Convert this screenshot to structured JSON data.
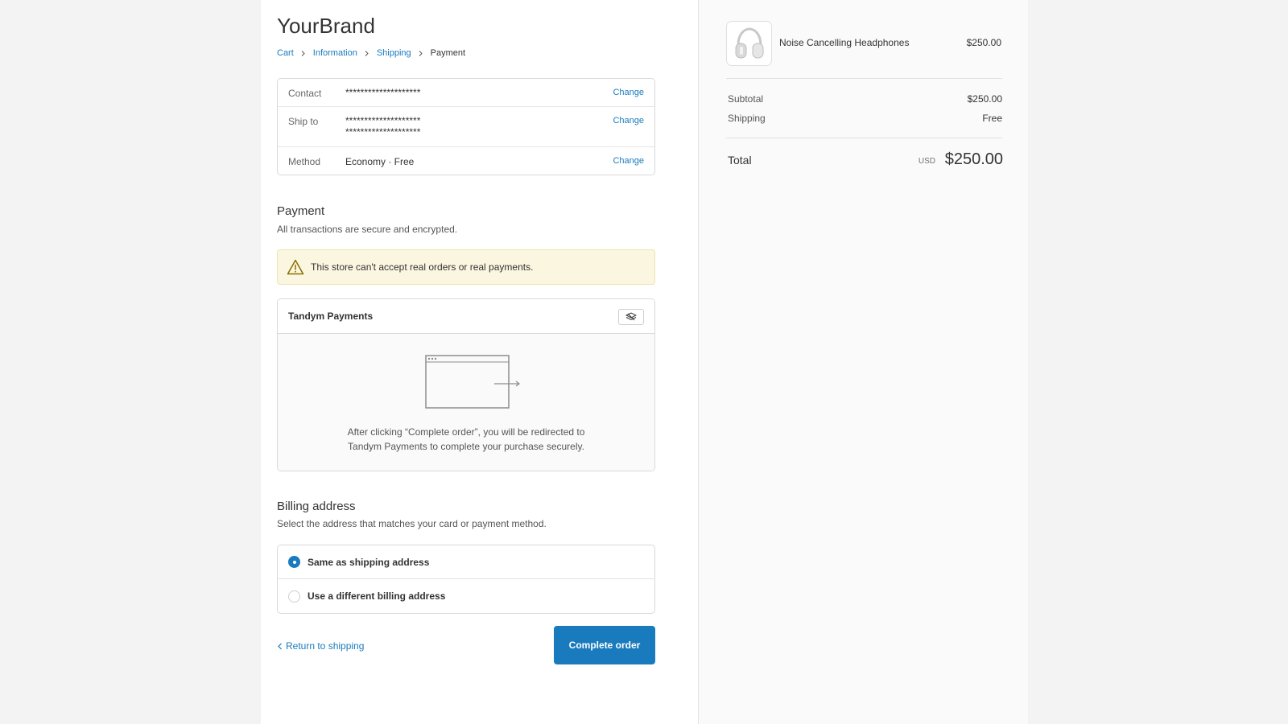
{
  "brand": "YourBrand",
  "breadcrumb": {
    "cart": "Cart",
    "information": "Information",
    "shipping": "Shipping",
    "payment": "Payment"
  },
  "review": {
    "contact_label": "Contact",
    "contact_value": "********************",
    "ship_label": "Ship to",
    "ship_line1": "********************",
    "ship_line2": "********************",
    "method_label": "Method",
    "method_value": "Economy · Free",
    "change": "Change"
  },
  "payment": {
    "title": "Payment",
    "subtitle": "All transactions are secure and encrypted.",
    "notice": "This store can't accept real orders or real payments.",
    "provider": "Tandym Payments",
    "redirect_line1": "After clicking “Complete order”, you will be redirected to",
    "redirect_line2": "Tandym Payments to complete your purchase securely."
  },
  "billing": {
    "title": "Billing address",
    "subtitle": "Select the address that matches your card or payment method.",
    "options": [
      {
        "label": "Same as shipping address",
        "selected": true
      },
      {
        "label": "Use a different billing address",
        "selected": false
      }
    ]
  },
  "actions": {
    "return": "Return to shipping",
    "complete": "Complete order"
  },
  "summary": {
    "product_name": "Noise Cancelling Headphones",
    "product_price": "$250.00",
    "subtotal_label": "Subtotal",
    "subtotal_value": "$250.00",
    "shipping_label": "Shipping",
    "shipping_value": "Free",
    "total_label": "Total",
    "currency": "USD",
    "total_value": "$250.00"
  },
  "colors": {
    "accent": "#197bbd",
    "notice_bg": "#fbf6e0"
  }
}
